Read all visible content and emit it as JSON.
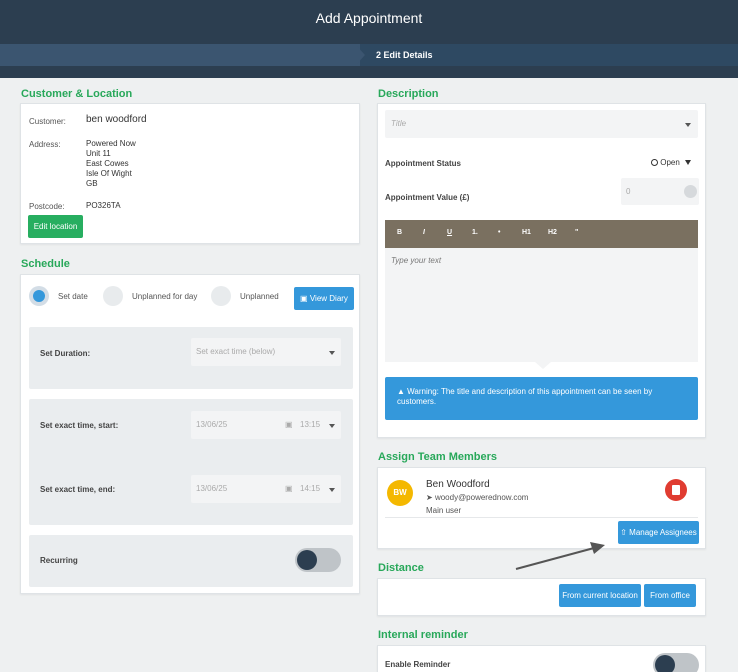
{
  "header": {
    "title": "Add Appointment",
    "step": "2 Edit Details"
  },
  "customer_location": {
    "title": "Customer & Location",
    "customer_label": "Customer:",
    "customer_value": "ben woodford",
    "address_label": "Address:",
    "address_lines": [
      "Powered Now",
      "Unit 11",
      "East Cowes",
      "Isle Of Wight",
      "GB"
    ],
    "postcode_label": "Postcode:",
    "postcode_value": "PO326TA",
    "edit_button": "Edit location"
  },
  "schedule": {
    "title": "Schedule",
    "options": [
      "Set date",
      "Unplanned for day",
      "Unplanned"
    ],
    "selected": "Set date",
    "view_diary": "View Diary",
    "duration_label": "Set Duration:",
    "duration_placeholder": "Set exact time (below)",
    "start_label": "Set exact time, start:",
    "start_date": "13/06/25",
    "start_time": "13:15",
    "end_label": "Set exact time, end:",
    "end_date": "13/06/25",
    "end_time": "14:15",
    "recurring_label": "Recurring"
  },
  "description": {
    "title": "Description",
    "title_placeholder": "Title",
    "status_label": "Appointment Status",
    "status_value": "Open",
    "value_label": "Appointment Value (£)",
    "value": "0",
    "toolbar": [
      "B",
      "I",
      "U",
      "1.",
      "•",
      "H1",
      "H2",
      "\""
    ],
    "text_placeholder": "Type your text",
    "warning": "Warning: The title and description of this appointment can be seen by customers."
  },
  "team": {
    "title": "Assign Team Members",
    "initials": "BW",
    "name": "Ben Woodford",
    "email": "woody@powerednow.com",
    "role": "Main user",
    "manage_button": "Manage Assignees"
  },
  "distance": {
    "title": "Distance",
    "current_button": "From current location",
    "office_button": "From office"
  },
  "reminder": {
    "title": "Internal reminder",
    "enable_label": "Enable Reminder"
  },
  "colors": {
    "accent_green": "#28a85a",
    "header": "#2c3e50",
    "button_blue": "#3498db"
  },
  "icons": [
    "calendar-icon",
    "caret-down-icon",
    "warning-icon",
    "trash-icon",
    "send-icon",
    "upload-icon"
  ]
}
